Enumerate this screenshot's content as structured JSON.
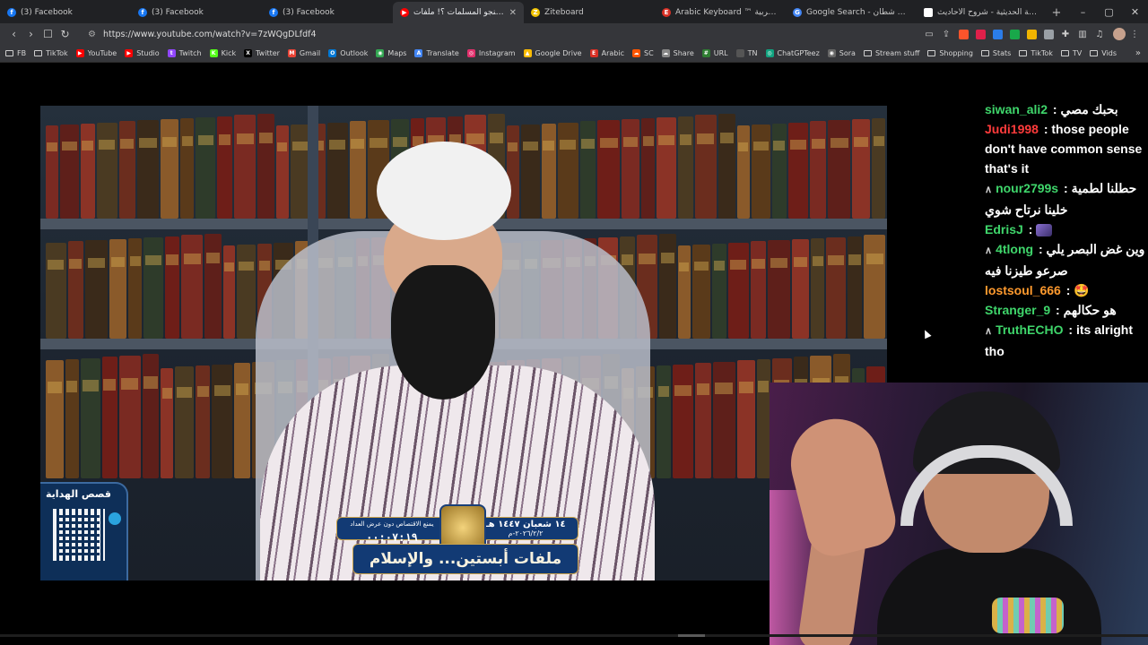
{
  "browser": {
    "tabs": [
      {
        "label": "(3) Facebook",
        "icon": "facebook-icon",
        "color": "#1877f2",
        "glyph": "f"
      },
      {
        "label": "(3) Facebook",
        "icon": "facebook-icon",
        "color": "#1877f2",
        "glyph": "f"
      },
      {
        "label": "(3) Facebook",
        "icon": "facebook-icon",
        "color": "#1877f2",
        "glyph": "f"
      },
      {
        "label": "لماذا ينجو المسلمات ؟! ملفات",
        "icon": "youtube-icon",
        "color": "#ff0000",
        "glyph": "▶",
        "active": true
      },
      {
        "label": "Ziteboard",
        "icon": "ziteboard-icon",
        "color": "#f2c400",
        "glyph": "Z"
      },
      {
        "label": "Arabic Keyboard ™ المفاتيح العربية",
        "icon": "arabic-keyboard-icon",
        "color": "#d93025",
        "glyph": "E"
      },
      {
        "label": "Google Search - تقبل بصورة شطان",
        "icon": "google-icon",
        "color": "#4285f4",
        "glyph": "G"
      },
      {
        "label": "الموسوعة الحديثية - شروح الأحاديث",
        "icon": "page-icon",
        "color": "#ffffff",
        "glyph": ""
      }
    ],
    "new_tab": "+",
    "window_controls": {
      "minimize": "–",
      "maximize": "▢",
      "close": "✕"
    },
    "url": "https://www.youtube.com/watch?v=7zWQgDLfdf4"
  },
  "bookmarks": [
    {
      "label": "FB",
      "kind": "folder"
    },
    {
      "label": "TikTok",
      "kind": "folder"
    },
    {
      "label": "YouTube",
      "kind": "site",
      "color": "#ff0000",
      "glyph": "▶"
    },
    {
      "label": "Studio",
      "kind": "site",
      "color": "#ff0000",
      "glyph": "▶"
    },
    {
      "label": "Twitch",
      "kind": "site",
      "color": "#9146ff",
      "glyph": "t"
    },
    {
      "label": "Kick",
      "kind": "site",
      "color": "#53fc18",
      "glyph": "K"
    },
    {
      "label": "Twitter",
      "kind": "site",
      "color": "#000000",
      "glyph": "X"
    },
    {
      "label": "Gmail",
      "kind": "site",
      "color": "#ea4335",
      "glyph": "M"
    },
    {
      "label": "Outlook",
      "kind": "site",
      "color": "#0078d4",
      "glyph": "O"
    },
    {
      "label": "Maps",
      "kind": "site",
      "color": "#34a853",
      "glyph": "◉"
    },
    {
      "label": "Translate",
      "kind": "site",
      "color": "#4285f4",
      "glyph": "A"
    },
    {
      "label": "Instagram",
      "kind": "site",
      "color": "#e1306c",
      "glyph": "◎"
    },
    {
      "label": "Google Drive",
      "kind": "site",
      "color": "#fbbc04",
      "glyph": "▲"
    },
    {
      "label": "Arabic",
      "kind": "site",
      "color": "#d93025",
      "glyph": "E"
    },
    {
      "label": "SC",
      "kind": "site",
      "color": "#ff5500",
      "glyph": "☁"
    },
    {
      "label": "Share",
      "kind": "site",
      "color": "#888888",
      "glyph": "☁"
    },
    {
      "label": "URL",
      "kind": "site",
      "color": "#2e7d32",
      "glyph": "#"
    },
    {
      "label": "TN",
      "kind": "site",
      "color": "#555555",
      "glyph": ""
    },
    {
      "label": "ChatGPTeez",
      "kind": "site",
      "color": "#10a37f",
      "glyph": "◎"
    },
    {
      "label": "Sora",
      "kind": "site",
      "color": "#666666",
      "glyph": "◉"
    },
    {
      "label": "Stream stuff",
      "kind": "folder"
    },
    {
      "label": "Shopping",
      "kind": "folder"
    },
    {
      "label": "Stats",
      "kind": "folder"
    },
    {
      "label": "TikTok",
      "kind": "folder"
    },
    {
      "label": "TV",
      "kind": "folder"
    },
    {
      "label": "Vids",
      "kind": "folder"
    }
  ],
  "video": {
    "qr_title": "قصص الهداية",
    "banner": {
      "timer_caption": "يمنع الاقتصاص دون عرض العداد",
      "timer": "٠٠:٠٧:١٩",
      "date_hijri": "١٤ شعبان ١٤٤٧ هـ",
      "date_gregorian": "٢٠٢٦/٢/٢-م",
      "headline": "ملفات أبستين... والإسلام"
    }
  },
  "chat": [
    {
      "user": "siwan_ali2",
      "color": "#3fd66b",
      "text": "بحبك مصي",
      "badge": ""
    },
    {
      "user": "Judi1998",
      "color": "#ff3b3b",
      "text": "those people don't have common sense that's it",
      "badge": ""
    },
    {
      "user": "nour2799s",
      "color": "#3fd66b",
      "text": "حطلنا لطمية خلينا نرتاح شوي",
      "badge": "∧"
    },
    {
      "user": "EdrisJ",
      "color": "#3fd66b",
      "text": "",
      "badge": "",
      "emote": true
    },
    {
      "user": "4tlong",
      "color": "#3fd66b",
      "text": "وين غض البصر يلي صرعو طيزنا فيه",
      "badge": "∧"
    },
    {
      "user": "lostsoul_666",
      "color": "#ff9a2e",
      "text": "🤩",
      "badge": ""
    },
    {
      "user": "Stranger_9",
      "color": "#3fd66b",
      "text": "هو حكالهم",
      "badge": ""
    },
    {
      "user": "TruthECHO",
      "color": "#3fd66b",
      "text": "its alright tho",
      "badge": "∧"
    }
  ]
}
